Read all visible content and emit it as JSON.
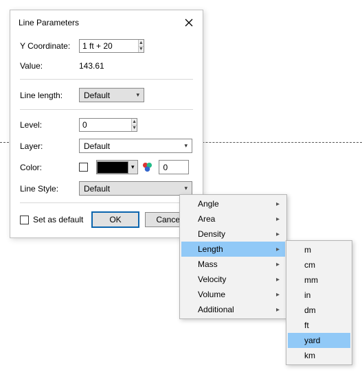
{
  "dialog": {
    "title": "Line Parameters",
    "ycoord_label": "Y Coordinate:",
    "ycoord_value": "1 ft + 20",
    "value_label": "Value:",
    "value_text": "143.61",
    "linelength_label": "Line length:",
    "linelength_value": "Default",
    "level_label": "Level:",
    "level_value": "0",
    "layer_label": "Layer:",
    "layer_value": "Default",
    "color_label": "Color:",
    "color_num": "0",
    "linestyle_label": "Line Style:",
    "linestyle_value": "Default",
    "setdefault_label": "Set as default",
    "ok_label": "OK",
    "cancel_label": "Cancel"
  },
  "menu1": {
    "items": [
      "Angle",
      "Area",
      "Density",
      "Length",
      "Mass",
      "Velocity",
      "Volume",
      "Additional"
    ],
    "highlighted": "Length"
  },
  "menu2": {
    "items": [
      "m",
      "cm",
      "mm",
      "in",
      "dm",
      "ft",
      "yard",
      "km"
    ],
    "highlighted": "yard"
  }
}
